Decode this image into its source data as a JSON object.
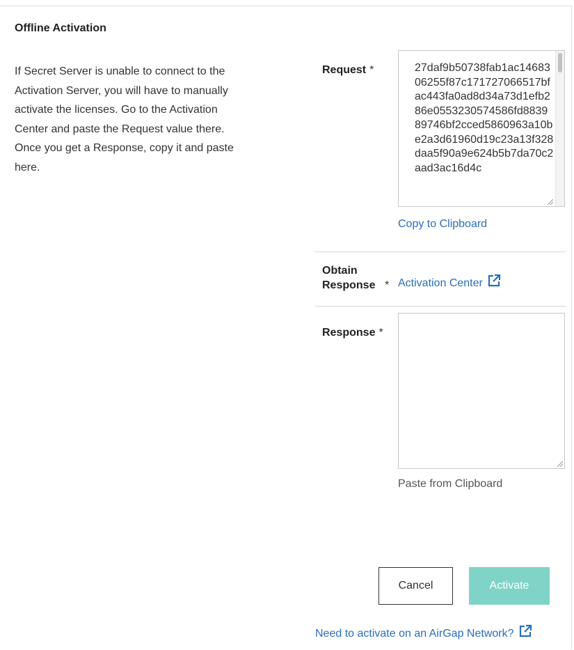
{
  "dialog": {
    "title": "Offline Activation",
    "description": "If Secret Server is unable to connect to the Activation Server, you will have to manually activate the licenses. Go to the Activation Center and paste the Request value there. Once you get a Response, copy it and paste here."
  },
  "request": {
    "label": "Request",
    "required_mark": "*",
    "value": "27daf9b50738fab1ac1468306255f87c171727066517bfac443fa0ad8d34a73d1efb286e0553230574586fd883989746bf2cced5860963a10be2a3d61960d19c23a13f328daa5f90a9e624b5b7da70c2aad3ac16d4c",
    "copy_link": "Copy to Clipboard"
  },
  "obtain": {
    "label": "Obtain Response",
    "required_mark": "*",
    "link": "Activation Center",
    "icon": "external-link-icon"
  },
  "response": {
    "label": "Response",
    "required_mark": "*",
    "value": "",
    "paste_hint": "Paste from Clipboard"
  },
  "actions": {
    "cancel_label": "Cancel",
    "activate_label": "Activate",
    "activate_color": "#7fd3c7",
    "link_color": "#2a6ebb"
  },
  "footer": {
    "airgap_link": "Need to activate on an AirGap Network?",
    "icon": "external-link-icon"
  }
}
